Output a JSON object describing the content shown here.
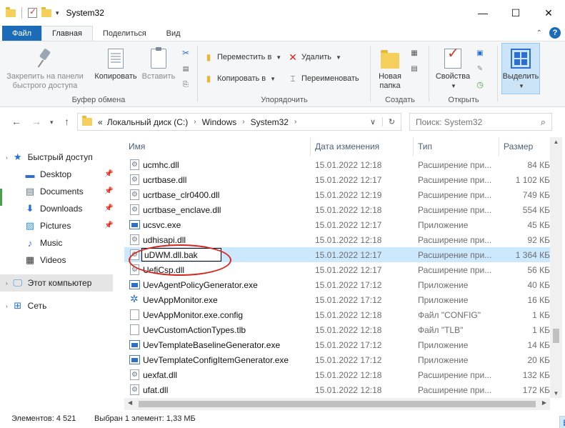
{
  "window": {
    "title": "System32",
    "controls": {
      "minimize": "—",
      "maximize": "☐",
      "close": "✕"
    }
  },
  "ribbon_tabs": [
    {
      "label": "Файл"
    },
    {
      "label": "Главная"
    },
    {
      "label": "Поделиться"
    },
    {
      "label": "Вид"
    }
  ],
  "ribbon": {
    "clipboard": {
      "pin_label_1": "Закрепить на панели",
      "pin_label_2": "быстрого доступа",
      "copy": "Копировать",
      "paste": "Вставить",
      "group": "Буфер обмена"
    },
    "organize": {
      "move": "Переместить в",
      "copy_to": "Копировать в",
      "delete": "Удалить",
      "rename": "Переименовать",
      "group": "Упорядочить"
    },
    "new": {
      "folder_1": "Новая",
      "folder_2": "папка",
      "group": "Создать"
    },
    "open": {
      "properties": "Свойства",
      "group": "Открыть"
    },
    "select": {
      "label": "Выделить"
    }
  },
  "address": {
    "prefix": "«",
    "segments": [
      "Локальный диск (C:)",
      "Windows",
      "System32"
    ],
    "search_placeholder": "Поиск: System32"
  },
  "nav_pane": [
    {
      "label": "Быстрый доступ",
      "icon": "star-icon"
    },
    {
      "label": "Desktop",
      "icon": "desktop-icon",
      "pinned": true
    },
    {
      "label": "Documents",
      "icon": "documents-icon",
      "pinned": true
    },
    {
      "label": "Downloads",
      "icon": "download-icon",
      "pinned": true
    },
    {
      "label": "Pictures",
      "icon": "pictures-icon",
      "pinned": true
    },
    {
      "label": "Music",
      "icon": "music-icon"
    },
    {
      "label": "Videos",
      "icon": "videos-icon"
    },
    {
      "label": "Этот компьютер",
      "icon": "computer-icon",
      "selected": true
    },
    {
      "label": "Сеть",
      "icon": "network-icon"
    }
  ],
  "columns": {
    "name": "Имя",
    "date": "Дата изменения",
    "type": "Тип",
    "size": "Размер"
  },
  "files": [
    {
      "name": "ucmhc.dll",
      "date": "15.01.2022 12:18",
      "type": "Расширение при...",
      "size": "84 КБ",
      "icon": "dll"
    },
    {
      "name": "ucrtbase.dll",
      "date": "15.01.2022 12:17",
      "type": "Расширение при...",
      "size": "1 102 КБ",
      "icon": "dll"
    },
    {
      "name": "ucrtbase_clr0400.dll",
      "date": "15.01.2022 12:19",
      "type": "Расширение при...",
      "size": "749 КБ",
      "icon": "dll"
    },
    {
      "name": "ucrtbase_enclave.dll",
      "date": "15.01.2022 12:18",
      "type": "Расширение при...",
      "size": "554 КБ",
      "icon": "dll"
    },
    {
      "name": "ucsvc.exe",
      "date": "15.01.2022 12:17",
      "type": "Приложение",
      "size": "45 КБ",
      "icon": "exe"
    },
    {
      "name": "udhisapi.dll",
      "date": "15.01.2022 12:18",
      "type": "Расширение при...",
      "size": "92 КБ",
      "icon": "dll"
    },
    {
      "name": "uDWM.dll.bak",
      "date": "15.01.2022 12:17",
      "type": "Расширение при...",
      "size": "1 364 КБ",
      "icon": "dll",
      "selected": true
    },
    {
      "name": "UefiCsp.dll",
      "date": "15.01.2022 12:17",
      "type": "Расширение при...",
      "size": "56 КБ",
      "icon": "dll"
    },
    {
      "name": "UevAgentPolicyGenerator.exe",
      "date": "15.01.2022 17:12",
      "type": "Приложение",
      "size": "40 КБ",
      "icon": "exe"
    },
    {
      "name": "UevAppMonitor.exe",
      "date": "15.01.2022 17:12",
      "type": "Приложение",
      "size": "16 КБ",
      "icon": "blue"
    },
    {
      "name": "UevAppMonitor.exe.config",
      "date": "15.01.2022 12:18",
      "type": "Файл \"CONFIG\"",
      "size": "1 КБ",
      "icon": "file"
    },
    {
      "name": "UevCustomActionTypes.tlb",
      "date": "15.01.2022 12:18",
      "type": "Файл \"TLB\"",
      "size": "1 КБ",
      "icon": "file"
    },
    {
      "name": "UevTemplateBaselineGenerator.exe",
      "date": "15.01.2022 17:12",
      "type": "Приложение",
      "size": "14 КБ",
      "icon": "exe"
    },
    {
      "name": "UevTemplateConfigItemGenerator.exe",
      "date": "15.01.2022 17:12",
      "type": "Приложение",
      "size": "20 КБ",
      "icon": "exe"
    },
    {
      "name": "uexfat.dll",
      "date": "15.01.2022 12:18",
      "type": "Расширение при...",
      "size": "132 КБ",
      "icon": "dll"
    },
    {
      "name": "ufat.dll",
      "date": "15.01.2022 12:18",
      "type": "Расширение при...",
      "size": "172 КБ",
      "icon": "dll"
    }
  ],
  "status": {
    "count": "Элементов: 4 521",
    "selection": "Выбран 1 элемент: 1,33 МБ"
  },
  "colors": {
    "accent": "#1b6bb9",
    "selection": "#cce8ff",
    "annotation": "#d8261f"
  }
}
